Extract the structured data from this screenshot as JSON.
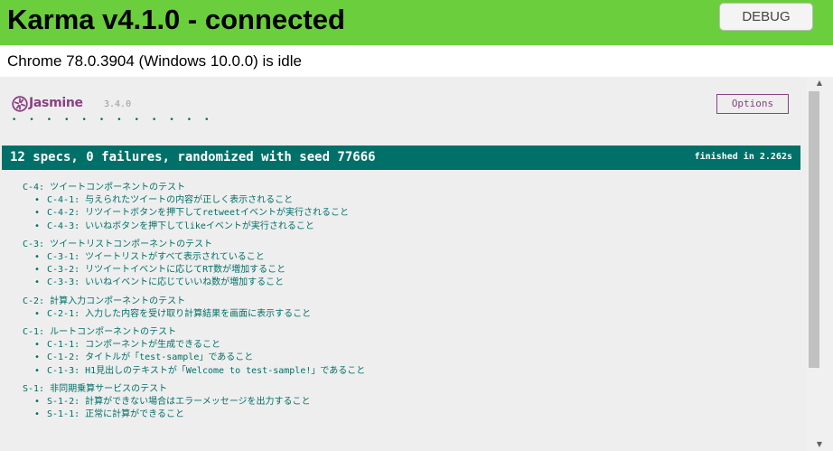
{
  "banner": {
    "title": "Karma v4.1.0 - connected",
    "debug_label": "DEBUG",
    "color": "#6bce3c"
  },
  "status": {
    "text": "Chrome 78.0.3904 (Windows 10.0.0) is idle"
  },
  "jasmine": {
    "name": "Jasmine",
    "version": "3.4.0",
    "options_label": "Options",
    "dots": "• • • • • • • • • • • •",
    "summary": "12 specs, 0 failures, randomized with seed 77666",
    "finished": "finished in 2.262s",
    "accent": "#007069",
    "brand": "#8a4182",
    "suites": [
      {
        "title": "C-4: ツイートコンポーネントのテスト",
        "specs": [
          "C-4-1: 与えられたツイートの内容が正しく表示されること",
          "C-4-2: リツイートボタンを押下してretweetイベントが実行されること",
          "C-4-3: いいねボタンを押下してlikeイベントが実行されること"
        ]
      },
      {
        "title": "C-3: ツイートリストコンポーネントのテスト",
        "specs": [
          "C-3-1: ツイートリストがすべて表示されていること",
          "C-3-2: リツイートイベントに応じてRT数が増加すること",
          "C-3-3: いいねイベントに応じていいね数が増加すること"
        ]
      },
      {
        "title": "C-2: 計算入力コンポーネントのテスト",
        "specs": [
          "C-2-1: 入力した内容を受け取り計算結果を画面に表示すること"
        ]
      },
      {
        "title": "C-1: ルートコンポーネントのテスト",
        "specs": [
          "C-1-1: コンポーネントが生成できること",
          "C-1-2: タイトルが「test-sample」であること",
          "C-1-3: H1見出しのテキストが「Welcome to test-sample!」であること"
        ]
      },
      {
        "title": "S-1: 非同期乗算サービスのテスト",
        "specs": [
          "S-1-2: 計算ができない場合はエラーメッセージを出力すること",
          "S-1-1: 正常に計算ができること"
        ]
      }
    ]
  }
}
